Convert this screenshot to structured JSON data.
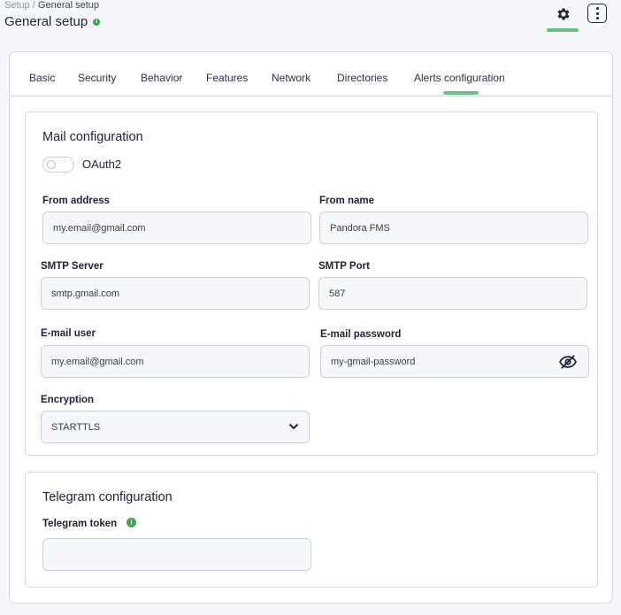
{
  "breadcrumb": {
    "parent": "Setup",
    "separator": " / ",
    "current": "General setup"
  },
  "page": {
    "title": "General setup",
    "info_icon": "info-icon"
  },
  "header_actions": {
    "settings_icon": "gear-icon",
    "menu_icon": "kebab-menu-icon"
  },
  "tabs": [
    {
      "label": "Basic"
    },
    {
      "label": "Security"
    },
    {
      "label": "Behavior"
    },
    {
      "label": "Features"
    },
    {
      "label": "Network"
    },
    {
      "label": "Directories"
    },
    {
      "label": "Alerts configuration",
      "active": true
    }
  ],
  "mail": {
    "title": "Mail configuration",
    "oauth_label": "OAuth2",
    "oauth_enabled": false,
    "from_address": {
      "label": "From address",
      "value": "my.email@gmail.com"
    },
    "from_name": {
      "label": "From name",
      "value": "Pandora FMS"
    },
    "smtp_server": {
      "label": "SMTP Server",
      "value": "smtp.gmail.com"
    },
    "smtp_port": {
      "label": "SMTP Port",
      "value": "587"
    },
    "email_user": {
      "label": "E-mail user",
      "value": "my.email@gmail.com"
    },
    "email_password": {
      "label": "E-mail password",
      "value": "my-gmail-password",
      "toggle_icon": "eye-off-icon"
    },
    "encryption": {
      "label": "Encryption",
      "value": "STARTTLS",
      "icon": "chevron-down-icon"
    }
  },
  "telegram": {
    "title": "Telegram configuration",
    "token": {
      "label": "Telegram token",
      "value": "",
      "info_icon": "info-icon"
    }
  },
  "colors": {
    "accent": "#6cbf84",
    "info": "#40a44a",
    "border": "#d4d8e0"
  }
}
